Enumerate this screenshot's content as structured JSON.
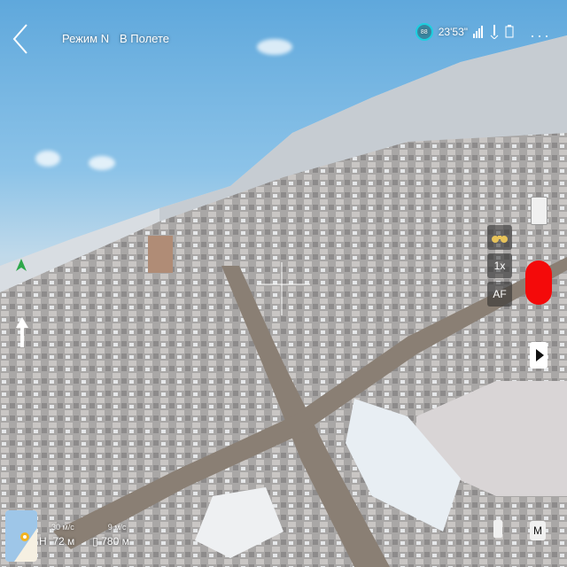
{
  "header": {
    "mode_label": "Режим N",
    "status_label": "В Полете",
    "time": "23'53\"",
    "battery_badge": "88"
  },
  "camera": {
    "zoom_label": "1x",
    "focus_label": "AF"
  },
  "telemetry": {
    "h_speed": "30 м/с",
    "v_speed": "9 м/с",
    "height_prefix": "H",
    "height": "72 м",
    "distance": "780 м"
  },
  "icons": {
    "back": "back-arrow-icon",
    "signal": "signal-bars-icon",
    "drone": "drone-icon",
    "battery": "battery-icon",
    "more": "more-dots-icon",
    "binoculars": "binoculars-icon",
    "home": "home-marker-icon",
    "compass": "compass-north-icon",
    "minimap": "minimap-icon",
    "play": "play-icon",
    "media": "media-icon",
    "mode": "mode-m-icon"
  },
  "colors": {
    "record": "#f40a0a",
    "battery_ring": "#1ecfe0",
    "north_arrow": "#2ea84a"
  }
}
